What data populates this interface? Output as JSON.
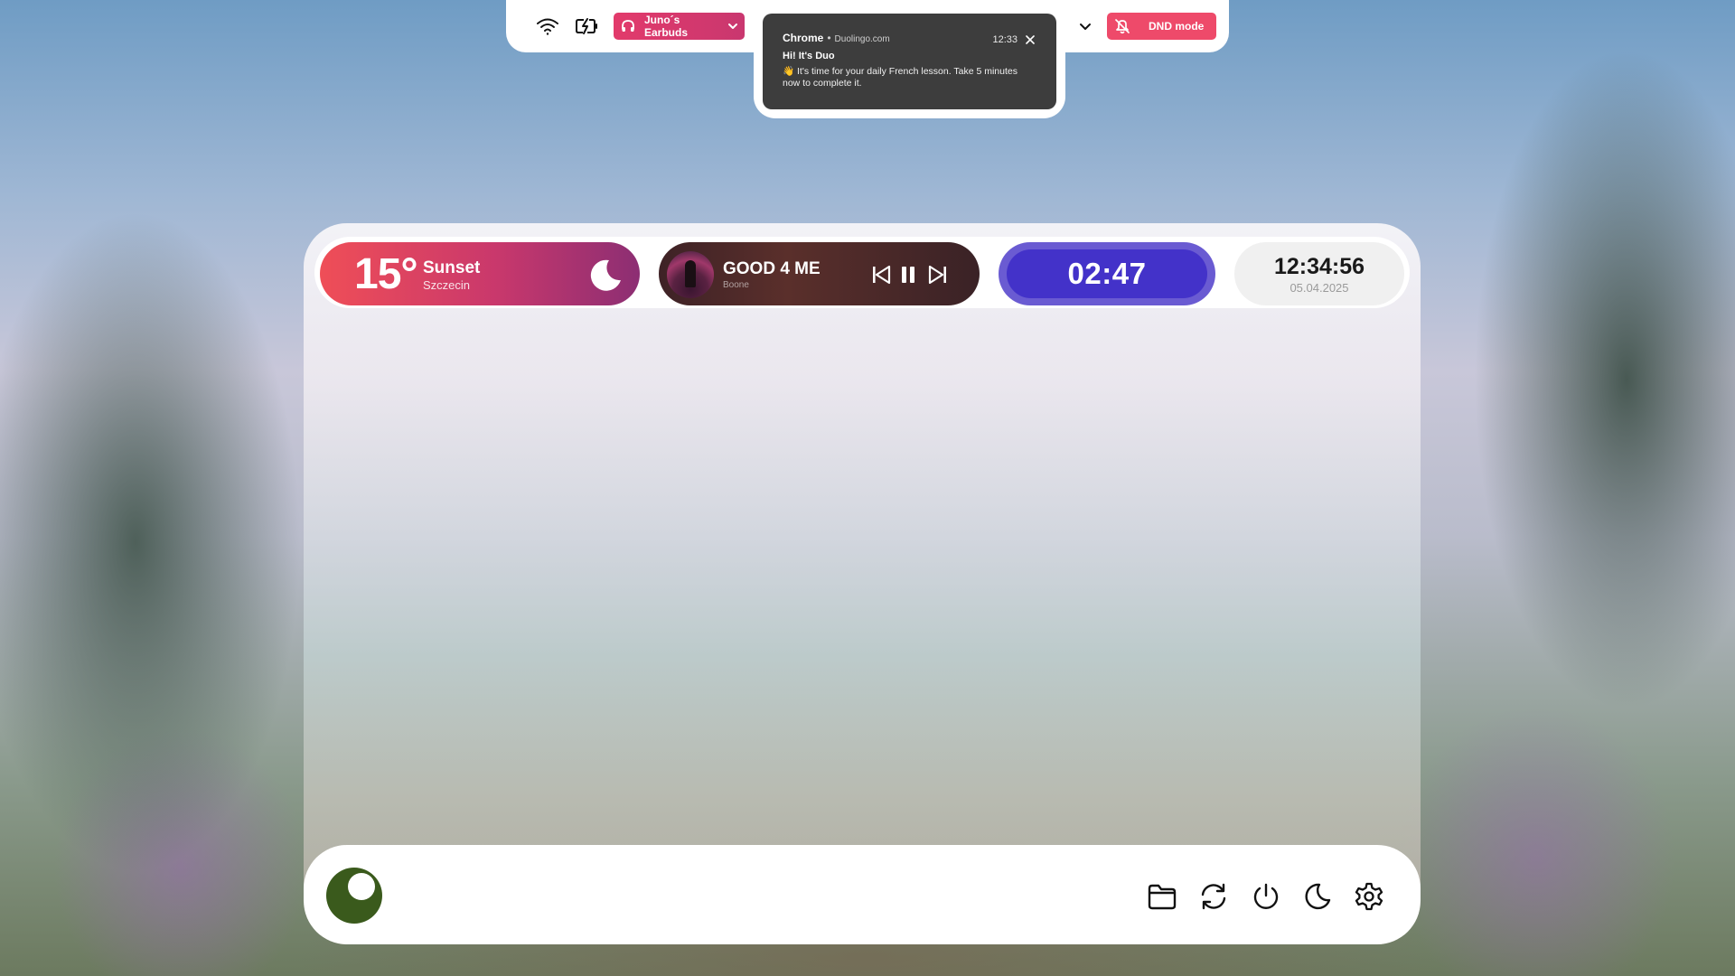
{
  "topbar": {
    "wifi_icon": "wifi-icon",
    "battery_icon": "battery-charging-icon",
    "audio_device": "Juno´s Earbuds",
    "dnd_label": "DND mode",
    "colors": {
      "earbuds": "#d63a6e",
      "dnd": "#ee4a6a"
    }
  },
  "notification": {
    "app": "Chrome",
    "separator": "•",
    "source": "Duolingo.com",
    "time": "12:33",
    "title": "Hi! It's Duo",
    "body": "👋 It's time for your daily French lesson. Take 5 minutes now to complete it."
  },
  "weather": {
    "temperature": "15°",
    "condition": "Sunset",
    "city": "Szczecin"
  },
  "music": {
    "title": "GOOD 4 ME",
    "artist": "Boone",
    "state": "playing"
  },
  "timer": {
    "remaining": "02:47",
    "colors": {
      "track": "#6a5bd2",
      "fill": "#4332c9"
    }
  },
  "clock": {
    "time": "12:34:56",
    "date": "05.04.2025"
  },
  "dock": {
    "avatar_color": "#3a5a1c",
    "buttons": [
      "folder-icon",
      "refresh-icon",
      "power-icon",
      "moon-icon",
      "settings-icon"
    ]
  }
}
